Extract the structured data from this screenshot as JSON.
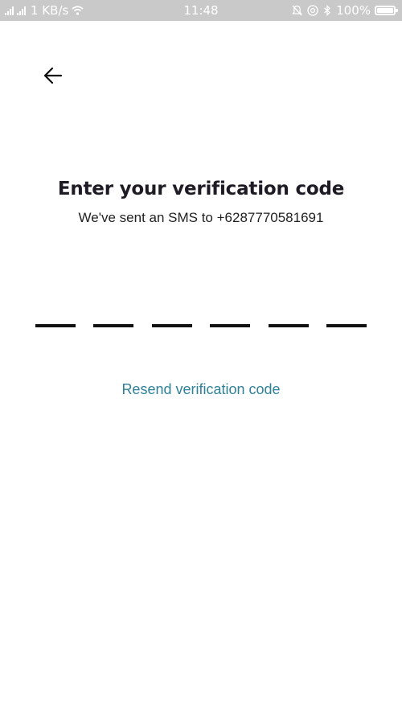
{
  "status_bar": {
    "network_speed": "1 KB/s",
    "time": "11:48",
    "battery": "100%",
    "battery_level": 1.0,
    "icons": [
      "signal-icon",
      "signal-icon",
      "wifi-icon",
      "alarm-icon",
      "location-icon",
      "bluetooth-icon",
      "battery-icon"
    ]
  },
  "header": {
    "back_icon": "arrow-left-icon"
  },
  "main": {
    "title": "Enter your verification code",
    "subtitle": "We've sent an SMS to +6287770581691",
    "code_length": 6,
    "code_values": [
      "",
      "",
      "",
      "",
      "",
      ""
    ],
    "resend_label": "Resend verification code"
  },
  "colors": {
    "title": "#1e1b24",
    "link": "#2f8197",
    "status_bar": "#c9c9c9",
    "dash": "#111111"
  }
}
